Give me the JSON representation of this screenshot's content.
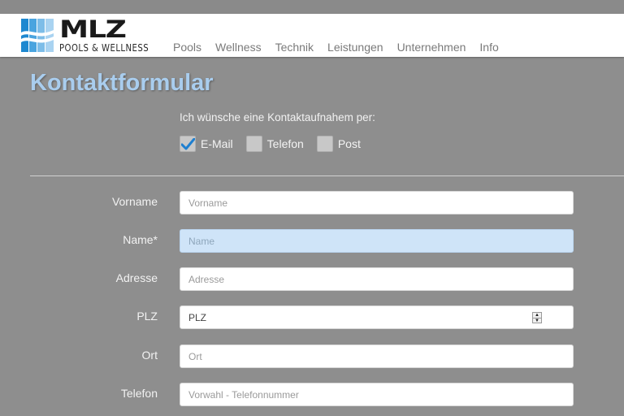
{
  "header": {
    "logo": {
      "name": "MLZ",
      "tagline": "POOLS & WELLNESS",
      "icon": "waves-pillars-logo-icon",
      "colors": [
        "#1e88d0",
        "#4aa4df",
        "#7dbde8",
        "#a9d3f1"
      ]
    },
    "nav": [
      "Pools",
      "Wellness",
      "Technik",
      "Leistungen",
      "Unternehmen",
      "Info"
    ]
  },
  "page": {
    "title": "Kontaktformular",
    "title_color": "#a9cdee",
    "contact_question": "Ich wünsche eine Kontaktaufnahem per:",
    "contact_methods": [
      {
        "label": "E-Mail",
        "checked": true
      },
      {
        "label": "Telefon",
        "checked": false
      },
      {
        "label": "Post",
        "checked": false
      }
    ],
    "check_color": "#1e7fd0"
  },
  "form": {
    "fields": [
      {
        "label": "Vorname",
        "placeholder": "Vorname",
        "value": "",
        "type": "text",
        "focused": false
      },
      {
        "label": "Name*",
        "placeholder": "Name",
        "value": "",
        "type": "text",
        "focused": true
      },
      {
        "label": "Adresse",
        "placeholder": "Adresse",
        "value": "",
        "type": "text",
        "focused": false
      },
      {
        "label": "PLZ",
        "placeholder": "PLZ",
        "value": "",
        "type": "number",
        "focused": false
      },
      {
        "label": "Ort",
        "placeholder": "Ort",
        "value": "",
        "type": "text",
        "focused": false
      },
      {
        "label": "Telefon",
        "placeholder": "Vorwahl - Telefonnummer",
        "value": "",
        "type": "text",
        "focused": false
      }
    ],
    "spinner": {
      "up": "▲",
      "down": "▼"
    }
  }
}
